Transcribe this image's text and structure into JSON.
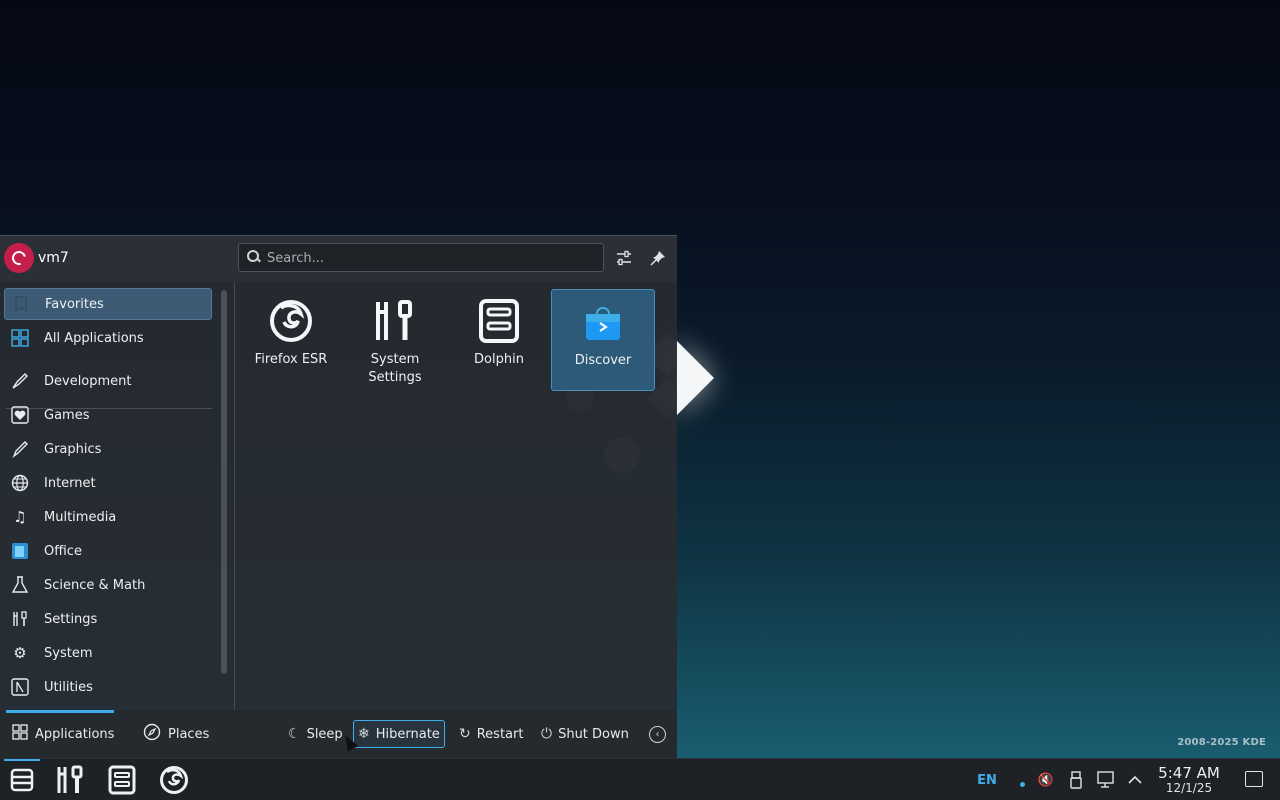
{
  "user": {
    "name": "vm7"
  },
  "search": {
    "placeholder": "Search..."
  },
  "sidebar": {
    "items": [
      {
        "label": "Favorites",
        "icon": "bookmark-icon"
      },
      {
        "label": "All Applications",
        "icon": "app-grid-icon"
      },
      {
        "label": "Development",
        "icon": "development-icon"
      },
      {
        "label": "Games",
        "icon": "games-icon"
      },
      {
        "label": "Graphics",
        "icon": "graphics-icon"
      },
      {
        "label": "Internet",
        "icon": "globe-icon"
      },
      {
        "label": "Multimedia",
        "icon": "music-note-icon"
      },
      {
        "label": "Office",
        "icon": "office-icon"
      },
      {
        "label": "Science & Math",
        "icon": "flask-icon"
      },
      {
        "label": "Settings",
        "icon": "settings-tools-icon"
      },
      {
        "label": "System",
        "icon": "gear-icon"
      },
      {
        "label": "Utilities",
        "icon": "utilities-icon"
      }
    ]
  },
  "favorites": [
    {
      "label": "Firefox ESR",
      "icon": "firefox-icon"
    },
    {
      "label": "System Settings",
      "icon": "system-settings-icon"
    },
    {
      "label": "Dolphin",
      "icon": "dolphin-icon"
    },
    {
      "label": "Discover",
      "icon": "discover-icon"
    }
  ],
  "footer": {
    "tabs": [
      {
        "label": "Applications",
        "icon": "app-grid-icon"
      },
      {
        "label": "Places",
        "icon": "compass-icon"
      }
    ],
    "power": [
      {
        "label": "Sleep",
        "icon": "sleep-icon"
      },
      {
        "label": "Hibernate",
        "icon": "hibernate-icon"
      },
      {
        "label": "Restart",
        "icon": "restart-icon"
      },
      {
        "label": "Shut Down",
        "icon": "power-icon"
      }
    ]
  },
  "wallpaper": {
    "credit": "2008-2025 KDE"
  },
  "taskbar": {
    "language": "EN",
    "time": "5:47 AM",
    "date": "12/1/25"
  },
  "colors": {
    "accent": "#3daee9",
    "selected": "#3c5a74",
    "panel": "#1e2125"
  }
}
